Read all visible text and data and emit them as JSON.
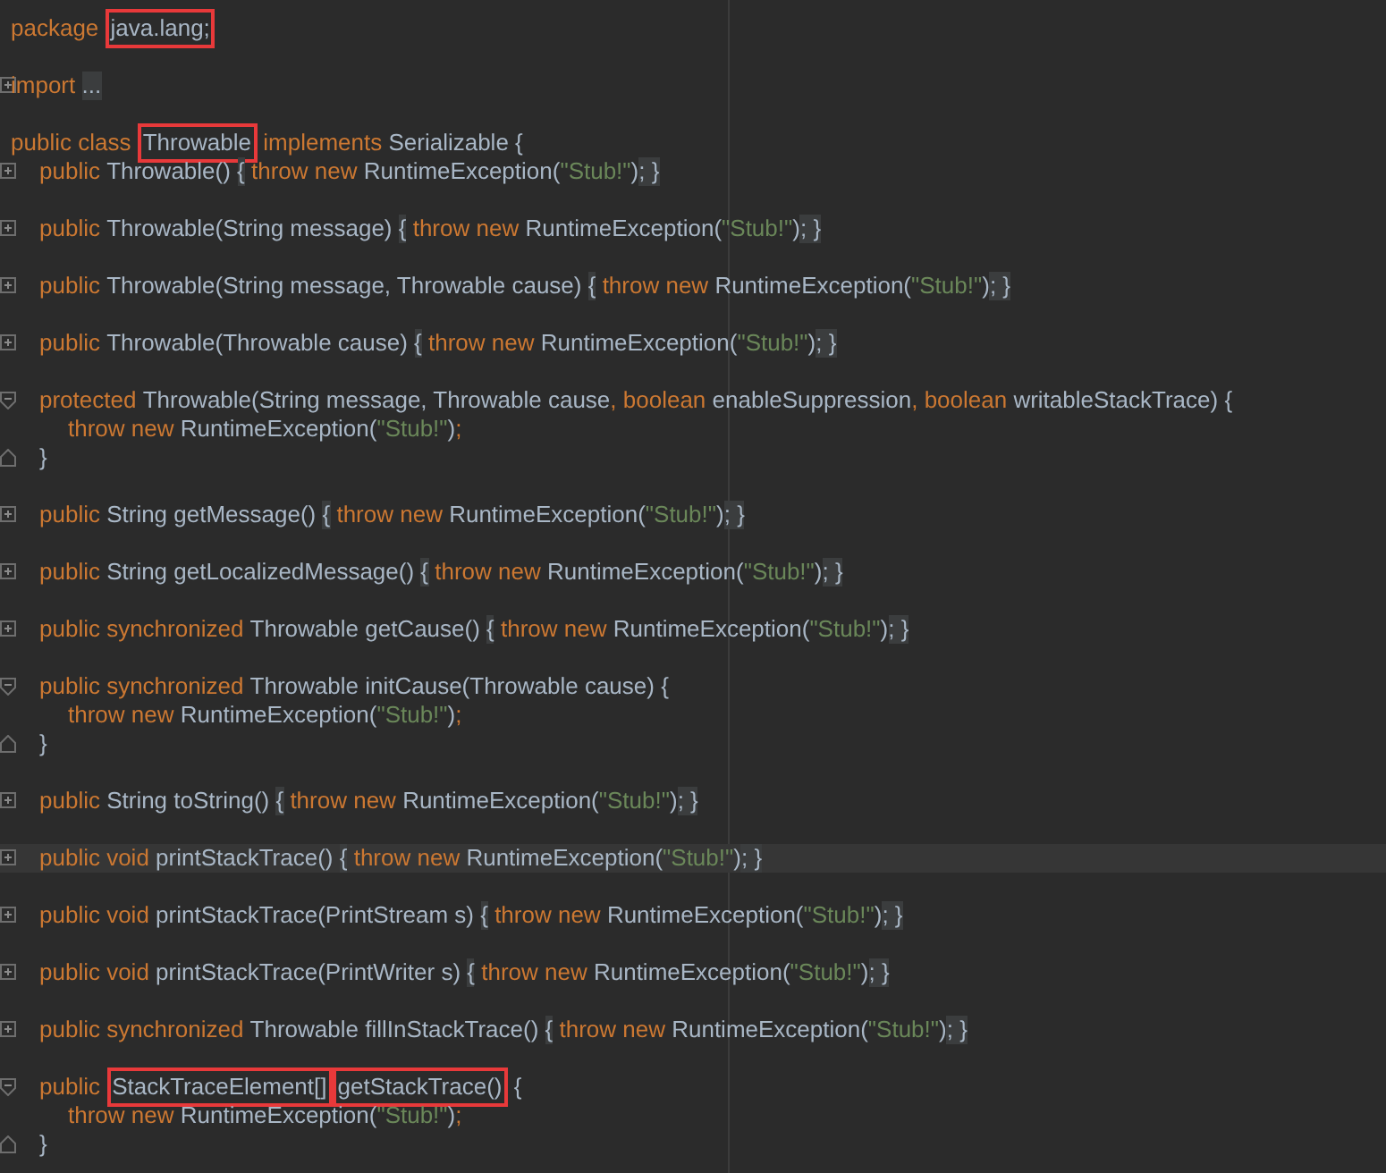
{
  "editor": {
    "lines": [
      {
        "tokens": [
          {
            "kind": "keyword",
            "text": "package "
          },
          {
            "kind": "plain",
            "text": "java.lang;",
            "boxed": true
          }
        ],
        "blank_after": true
      },
      {
        "collapsed": true,
        "tokens": [
          {
            "kind": "keyword",
            "text": "import "
          },
          {
            "kind": "fold",
            "text": "..."
          }
        ],
        "blank_after": true
      },
      {
        "tokens": [
          {
            "kind": "keyword",
            "text": "public class "
          },
          {
            "kind": "plain",
            "text": "Throwable",
            "boxed": true
          },
          {
            "kind": "keyword",
            "text": " implements "
          },
          {
            "kind": "plain",
            "text": "Serializable {"
          }
        ],
        "children": [
          {
            "collapsed": true,
            "tokens": [
              {
                "kind": "keyword",
                "text": "public "
              },
              {
                "kind": "plain",
                "text": "Throwable() "
              },
              {
                "kind": "fold",
                "text": "{"
              },
              {
                "kind": "keyword",
                "text": " throw new "
              },
              {
                "kind": "plain",
                "text": "RuntimeException("
              },
              {
                "kind": "string",
                "text": "\"Stub!\""
              },
              {
                "kind": "plain",
                "text": ")"
              },
              {
                "kind": "fold",
                "text": "; }"
              }
            ],
            "blank_after": true
          },
          {
            "collapsed": true,
            "tokens": [
              {
                "kind": "keyword",
                "text": "public "
              },
              {
                "kind": "plain",
                "text": "Throwable(String message) "
              },
              {
                "kind": "fold",
                "text": "{"
              },
              {
                "kind": "keyword",
                "text": " throw new "
              },
              {
                "kind": "plain",
                "text": "RuntimeException("
              },
              {
                "kind": "string",
                "text": "\"Stub!\""
              },
              {
                "kind": "plain",
                "text": ")"
              },
              {
                "kind": "fold",
                "text": "; }"
              }
            ],
            "blank_after": true
          },
          {
            "collapsed": true,
            "tokens": [
              {
                "kind": "keyword",
                "text": "public "
              },
              {
                "kind": "plain",
                "text": "Throwable(String message, Throwable cause) "
              },
              {
                "kind": "fold",
                "text": "{"
              },
              {
                "kind": "keyword",
                "text": " throw new "
              },
              {
                "kind": "plain",
                "text": "RuntimeException("
              },
              {
                "kind": "string",
                "text": "\"Stub!\""
              },
              {
                "kind": "plain",
                "text": ")"
              },
              {
                "kind": "fold",
                "text": "; }"
              }
            ],
            "blank_after": true
          },
          {
            "collapsed": true,
            "tokens": [
              {
                "kind": "keyword",
                "text": "public "
              },
              {
                "kind": "plain",
                "text": "Throwable(Throwable cause) "
              },
              {
                "kind": "fold",
                "text": "{"
              },
              {
                "kind": "keyword",
                "text": " throw new "
              },
              {
                "kind": "plain",
                "text": "RuntimeException("
              },
              {
                "kind": "string",
                "text": "\"Stub!\""
              },
              {
                "kind": "plain",
                "text": ")"
              },
              {
                "kind": "fold",
                "text": "; }"
              }
            ],
            "blank_after": true
          },
          {
            "collapsed": false,
            "tokens": [
              {
                "kind": "keyword",
                "text": "protected "
              },
              {
                "kind": "plain",
                "text": "Throwable(String message, Throwable cause"
              },
              {
                "kind": "keyword",
                "text": ", boolean "
              },
              {
                "kind": "plain",
                "text": "enableSuppression"
              },
              {
                "kind": "keyword",
                "text": ", boolean "
              },
              {
                "kind": "plain",
                "text": "writableStackTrace) {"
              }
            ],
            "children": [
              {
                "tokens": [
                  {
                    "kind": "keyword",
                    "text": "throw new "
                  },
                  {
                    "kind": "plain",
                    "text": "RuntimeException("
                  },
                  {
                    "kind": "string",
                    "text": "\"Stub!\""
                  },
                  {
                    "kind": "plain",
                    "text": ")"
                  },
                  {
                    "kind": "keyword",
                    "text": ";"
                  }
                ]
              }
            ]
          },
          {
            "fold_end": true,
            "tokens": [
              {
                "kind": "plain",
                "text": "}"
              }
            ],
            "blank_after": true
          },
          {
            "collapsed": true,
            "tokens": [
              {
                "kind": "keyword",
                "text": "public "
              },
              {
                "kind": "plain",
                "text": "String getMessage() "
              },
              {
                "kind": "fold",
                "text": "{"
              },
              {
                "kind": "keyword",
                "text": " throw new "
              },
              {
                "kind": "plain",
                "text": "RuntimeException("
              },
              {
                "kind": "string",
                "text": "\"Stub!\""
              },
              {
                "kind": "plain",
                "text": ")"
              },
              {
                "kind": "fold",
                "text": "; }"
              }
            ],
            "blank_after": true
          },
          {
            "collapsed": true,
            "tokens": [
              {
                "kind": "keyword",
                "text": "public "
              },
              {
                "kind": "plain",
                "text": "String getLocalizedMessage() "
              },
              {
                "kind": "fold",
                "text": "{"
              },
              {
                "kind": "keyword",
                "text": " throw new "
              },
              {
                "kind": "plain",
                "text": "RuntimeException("
              },
              {
                "kind": "string",
                "text": "\"Stub!\""
              },
              {
                "kind": "plain",
                "text": ")"
              },
              {
                "kind": "fold",
                "text": "; }"
              }
            ],
            "blank_after": true
          },
          {
            "collapsed": true,
            "tokens": [
              {
                "kind": "keyword",
                "text": "public synchronized "
              },
              {
                "kind": "plain",
                "text": "Throwable getCause() "
              },
              {
                "kind": "fold",
                "text": "{"
              },
              {
                "kind": "keyword",
                "text": " throw new "
              },
              {
                "kind": "plain",
                "text": "RuntimeException("
              },
              {
                "kind": "string",
                "text": "\"Stub!\""
              },
              {
                "kind": "plain",
                "text": ")"
              },
              {
                "kind": "fold",
                "text": "; }"
              }
            ],
            "blank_after": true
          },
          {
            "collapsed": false,
            "tokens": [
              {
                "kind": "keyword",
                "text": "public synchronized "
              },
              {
                "kind": "plain",
                "text": "Throwable initCause(Throwable cause) {"
              }
            ],
            "children": [
              {
                "tokens": [
                  {
                    "kind": "keyword",
                    "text": "throw new "
                  },
                  {
                    "kind": "plain",
                    "text": "RuntimeException("
                  },
                  {
                    "kind": "string",
                    "text": "\"Stub!\""
                  },
                  {
                    "kind": "plain",
                    "text": ")"
                  },
                  {
                    "kind": "keyword",
                    "text": ";"
                  }
                ]
              }
            ]
          },
          {
            "fold_end": true,
            "tokens": [
              {
                "kind": "plain",
                "text": "}"
              }
            ],
            "blank_after": true
          },
          {
            "collapsed": true,
            "tokens": [
              {
                "kind": "keyword",
                "text": "public "
              },
              {
                "kind": "plain",
                "text": "String toString() "
              },
              {
                "kind": "fold",
                "text": "{"
              },
              {
                "kind": "keyword",
                "text": " throw new "
              },
              {
                "kind": "plain",
                "text": "RuntimeException("
              },
              {
                "kind": "string",
                "text": "\"Stub!\""
              },
              {
                "kind": "plain",
                "text": ")"
              },
              {
                "kind": "fold",
                "text": "; }"
              }
            ],
            "blank_after": true
          },
          {
            "collapsed": true,
            "current": true,
            "tokens": [
              {
                "kind": "keyword",
                "text": "public void "
              },
              {
                "kind": "plain",
                "text": "printStackTrace() "
              },
              {
                "kind": "fold",
                "text": "{"
              },
              {
                "kind": "keyword",
                "text": " throw new "
              },
              {
                "kind": "plain",
                "text": "RuntimeException("
              },
              {
                "kind": "string",
                "text": "\"Stub!\""
              },
              {
                "kind": "plain",
                "text": ")"
              },
              {
                "kind": "fold",
                "text": "; }"
              }
            ],
            "blank_after": true
          },
          {
            "collapsed": true,
            "tokens": [
              {
                "kind": "keyword",
                "text": "public void "
              },
              {
                "kind": "plain",
                "text": "printStackTrace(PrintStream s) "
              },
              {
                "kind": "fold",
                "text": "{"
              },
              {
                "kind": "keyword",
                "text": " throw new "
              },
              {
                "kind": "plain",
                "text": "RuntimeException("
              },
              {
                "kind": "string",
                "text": "\"Stub!\""
              },
              {
                "kind": "plain",
                "text": ")"
              },
              {
                "kind": "fold",
                "text": "; }"
              }
            ],
            "blank_after": true
          },
          {
            "collapsed": true,
            "tokens": [
              {
                "kind": "keyword",
                "text": "public void "
              },
              {
                "kind": "plain",
                "text": "printStackTrace(PrintWriter s) "
              },
              {
                "kind": "fold",
                "text": "{"
              },
              {
                "kind": "keyword",
                "text": " throw new "
              },
              {
                "kind": "plain",
                "text": "RuntimeException("
              },
              {
                "kind": "string",
                "text": "\"Stub!\""
              },
              {
                "kind": "plain",
                "text": ")"
              },
              {
                "kind": "fold",
                "text": "; }"
              }
            ],
            "blank_after": true
          },
          {
            "collapsed": true,
            "tokens": [
              {
                "kind": "keyword",
                "text": "public synchronized "
              },
              {
                "kind": "plain",
                "text": "Throwable fillInStackTrace() "
              },
              {
                "kind": "fold",
                "text": "{"
              },
              {
                "kind": "keyword",
                "text": " throw new "
              },
              {
                "kind": "plain",
                "text": "RuntimeException("
              },
              {
                "kind": "string",
                "text": "\"Stub!\""
              },
              {
                "kind": "plain",
                "text": ")"
              },
              {
                "kind": "fold",
                "text": "; }"
              }
            ],
            "blank_after": true
          },
          {
            "collapsed": false,
            "tokens": [
              {
                "kind": "keyword",
                "text": "public "
              },
              {
                "kind": "plain",
                "text": "StackTraceElement[]",
                "boxed": true
              },
              {
                "kind": "plain",
                "text": "getStackTrace()",
                "boxed": true
              },
              {
                "kind": "plain",
                "text": " {"
              }
            ],
            "children": [
              {
                "tokens": [
                  {
                    "kind": "keyword",
                    "text": "throw new "
                  },
                  {
                    "kind": "plain",
                    "text": "RuntimeException("
                  },
                  {
                    "kind": "string",
                    "text": "\"Stub!\""
                  },
                  {
                    "kind": "plain",
                    "text": ")"
                  },
                  {
                    "kind": "keyword",
                    "text": ";"
                  }
                ]
              }
            ]
          },
          {
            "fold_end": true,
            "tokens": [
              {
                "kind": "plain",
                "text": "}"
              }
            ]
          }
        ]
      }
    ]
  }
}
